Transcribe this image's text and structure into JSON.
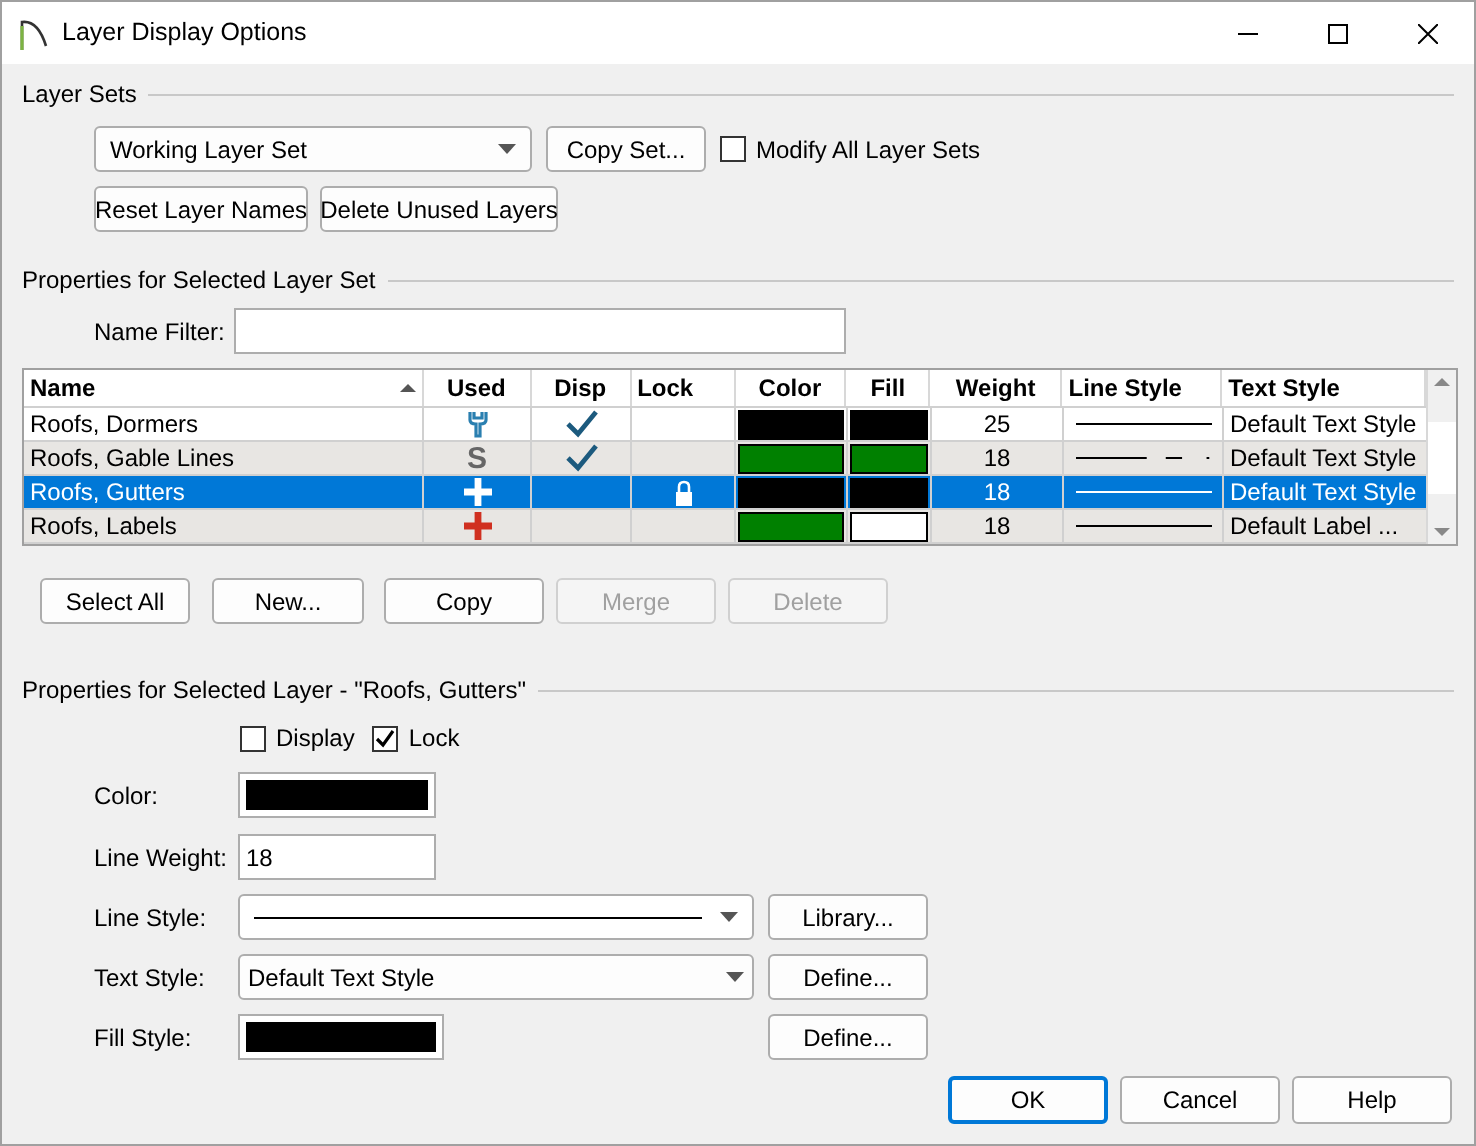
{
  "window": {
    "title": "Layer Display Options"
  },
  "layer_sets": {
    "heading": "Layer Sets",
    "set_select": "Working Layer Set",
    "copy_button": "Copy Set...",
    "modify_all": {
      "label": "Modify All Layer Sets",
      "checked": false
    },
    "reset_button": "Reset Layer Names",
    "delete_unused_button": "Delete Unused Layers"
  },
  "set_properties": {
    "heading": "Properties for Selected Layer Set",
    "name_filter_label": "Name Filter:"
  },
  "table": {
    "columns": [
      "Name",
      "Used",
      "Disp",
      "Lock",
      "Color",
      "Fill",
      "Weight",
      "Line Style",
      "Text Style"
    ],
    "rows": [
      {
        "name": "Roofs, Dormers",
        "used": {
          "kind": "wrench"
        },
        "disp": true,
        "lock": false,
        "color": "#000000",
        "fill": {
          "color": "#000000"
        },
        "weight": "25",
        "line_style": {
          "kind": "solid"
        },
        "text_style": "Default Text Style",
        "selected": false
      },
      {
        "name": "Roofs, Gable Lines",
        "used": {
          "kind": "letter",
          "text": "S"
        },
        "disp": true,
        "lock": false,
        "color": "#008000",
        "fill": {
          "color": "#008000"
        },
        "weight": "18",
        "line_style": {
          "kind": "dashdot"
        },
        "text_style": "Default Text Style",
        "selected": false
      },
      {
        "name": "Roofs, Gutters",
        "used": {
          "kind": "plus"
        },
        "disp": false,
        "lock": true,
        "color": "#000000",
        "fill": {
          "color": "#000000"
        },
        "weight": "18",
        "line_style": {
          "kind": "solid"
        },
        "text_style": "Default Text Style",
        "selected": true
      },
      {
        "name": "Roofs, Labels",
        "used": {
          "kind": "plus"
        },
        "disp": false,
        "lock": false,
        "color": "#008000",
        "fill": {
          "color": "#ffffff"
        },
        "weight": "18",
        "line_style": {
          "kind": "solid"
        },
        "text_style": "Default Label ...",
        "selected": false
      }
    ]
  },
  "table_buttons": [
    {
      "label": "Select All",
      "disabled": false
    },
    {
      "label": "New...",
      "disabled": false
    },
    {
      "label": "Copy",
      "disabled": false
    },
    {
      "label": "Merge",
      "disabled": true
    },
    {
      "label": "Delete",
      "disabled": true
    }
  ],
  "layer_properties": {
    "heading": "Properties for Selected Layer - \"Roofs, Gutters\"",
    "display": {
      "label": "Display",
      "checked": false
    },
    "lock": {
      "label": "Lock",
      "checked": true
    },
    "color_label": "Color:",
    "color": "#000000",
    "line_weight_label": "Line Weight:",
    "line_weight": "18",
    "line_style_label": "Line Style:",
    "line_style": {
      "kind": "solid"
    },
    "library_button": "Library...",
    "text_style_label": "Text Style:",
    "text_style": "Default Text Style",
    "text_define_button": "Define...",
    "fill_style_label": "Fill Style:",
    "fill": {
      "color": "#000000"
    },
    "fill_define_button": "Define..."
  },
  "footer_buttons": [
    {
      "label": "OK",
      "default": true
    },
    {
      "label": "Cancel",
      "default": false
    },
    {
      "label": "Help",
      "default": false
    }
  ]
}
